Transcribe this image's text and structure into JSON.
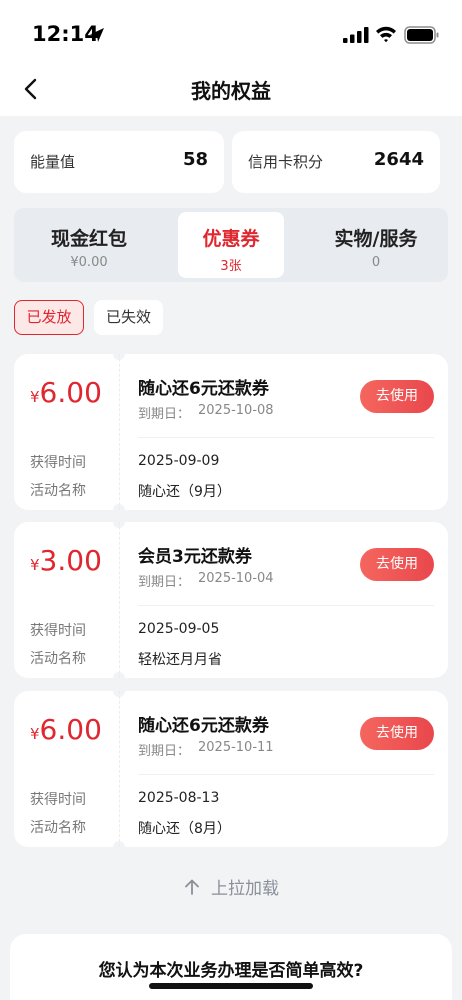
{
  "status_bar": {
    "time": "12:14"
  },
  "nav": {
    "title": "我的权益"
  },
  "stats": [
    {
      "label": "能量值",
      "value": "58"
    },
    {
      "label": "信用卡积分",
      "value": "2644"
    }
  ],
  "tabs": [
    {
      "label": "现金红包",
      "sub": "¥0.00"
    },
    {
      "label": "优惠券",
      "sub": "3张"
    },
    {
      "label": "实物/服务",
      "sub": "0"
    }
  ],
  "filters": {
    "active": "已发放",
    "inactive": "已失效"
  },
  "coupon_labels": {
    "currency": "¥",
    "expiry_label": "到期日：",
    "use_button": "去使用",
    "obtained_label": "获得时间",
    "campaign_label": "活动名称"
  },
  "coupons": [
    {
      "amount": "6.00",
      "name": "随心还6元还款券",
      "expiry": "2025-10-08",
      "obtained": "2025-09-09",
      "campaign": "随心还（9月）"
    },
    {
      "amount": "3.00",
      "name": "会员3元还款券",
      "expiry": "2025-10-04",
      "obtained": "2025-09-05",
      "campaign": "轻松还月月省"
    },
    {
      "amount": "6.00",
      "name": "随心还6元还款券",
      "expiry": "2025-10-11",
      "obtained": "2025-08-13",
      "campaign": "随心还（8月）"
    }
  ],
  "pull_text": "上拉加载",
  "survey": {
    "question": "您认为本次业务办理是否简单高效?"
  },
  "colors": {
    "accent": "#e0262e",
    "background": "#f2f3f5"
  }
}
